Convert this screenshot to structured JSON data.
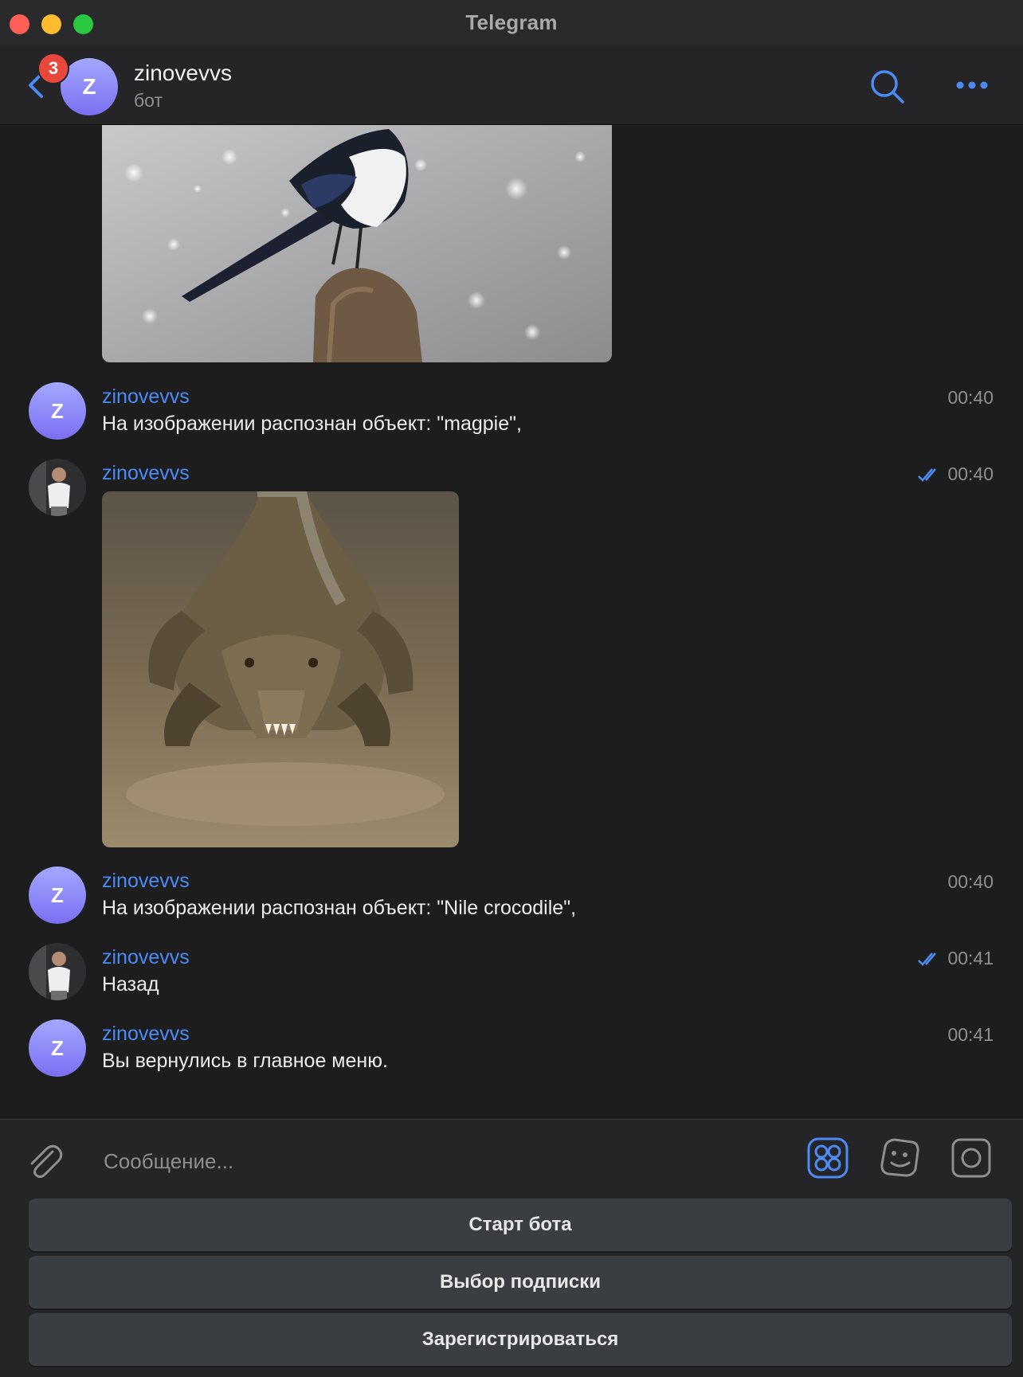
{
  "window": {
    "title": "Telegram"
  },
  "header": {
    "unread_badge": "3",
    "avatar_letter": "Z",
    "chat_name": "zinovevvs",
    "chat_status": "бот"
  },
  "messages": [
    {
      "sender": "zinovevvs",
      "time": "00:40",
      "text": "На изображении распознан объект: \"magpie\",",
      "avatar_letter": "Z"
    },
    {
      "sender": "zinovevvs",
      "time": "00:40"
    },
    {
      "sender": "zinovevvs",
      "time": "00:40",
      "text": "На изображении распознан объект: \"Nile crocodile\",",
      "avatar_letter": "Z"
    },
    {
      "sender": "zinovevvs",
      "time": "00:41",
      "text": "Назад"
    },
    {
      "sender": "zinovevvs",
      "time": "00:41",
      "text": "Вы вернулись в главное меню.",
      "avatar_letter": "Z"
    }
  ],
  "composer": {
    "placeholder": "Сообщение..."
  },
  "keyboard": [
    {
      "label": "Старт бота"
    },
    {
      "label": "Выбор подписки"
    },
    {
      "label": "Зарегистрироваться"
    }
  ],
  "colors": {
    "accent": "#4a8bf5",
    "badge": "#e9473c",
    "background": "#1d1d1e",
    "bot_avatar": "#8f8bf8"
  },
  "icons": [
    "back-chevron-icon",
    "search-icon",
    "more-icon",
    "paperclip-icon",
    "bot-menu-icon",
    "sticker-icon",
    "camera-icon",
    "double-check-icon"
  ]
}
